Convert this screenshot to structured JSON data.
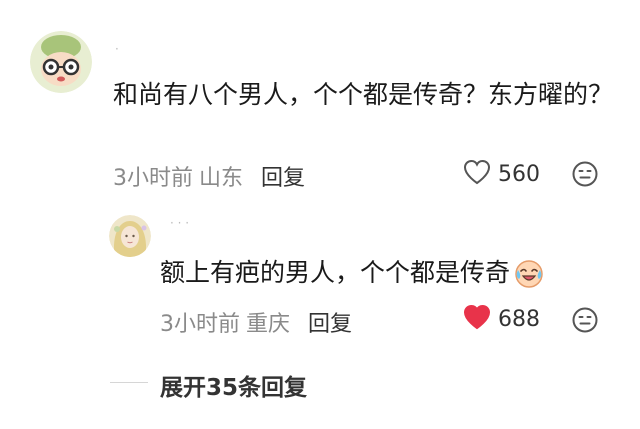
{
  "comment": {
    "username": "·",
    "text": "和尚有八个男人，个个都是传奇？东方曜的？",
    "time": "3小时前",
    "location": "山东",
    "reply_label": "回复",
    "likes": "560",
    "liked": false
  },
  "reply": {
    "username": "·  ·  ·",
    "text": "额上有疤的男人，个个都是传奇",
    "time": "3小时前",
    "location": "重庆",
    "reply_label": "回复",
    "likes": "688",
    "liked": true,
    "like_color": "#e8334a"
  },
  "expand": {
    "label": "展开35条回复"
  },
  "icons": {
    "like": "heart-icon",
    "dislike": "dislike-face-icon",
    "emoji": "crying-laughing-emoji-icon"
  }
}
